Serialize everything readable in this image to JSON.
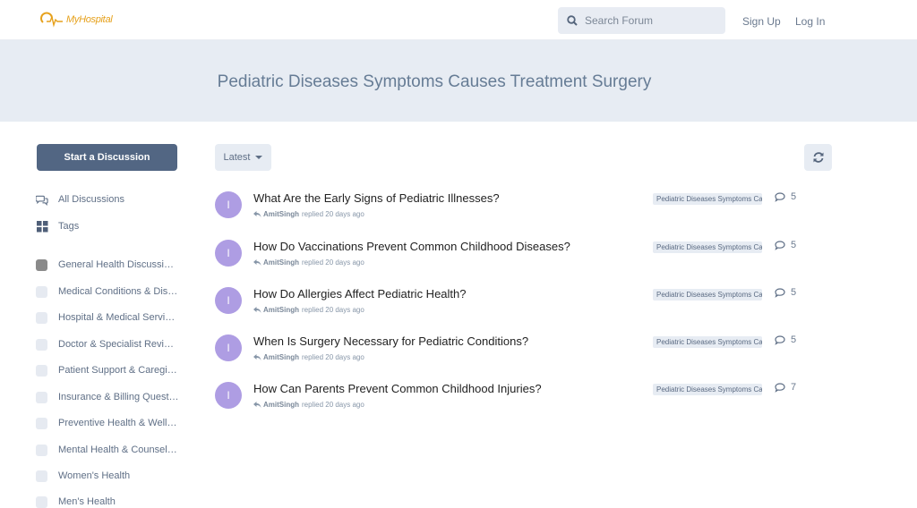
{
  "header": {
    "logo_text": "MyHospital",
    "search_placeholder": "Search Forum",
    "signup_label": "Sign Up",
    "login_label": "Log In"
  },
  "hero": {
    "title": "Pediatric Diseases Symptoms Causes Treatment Surgery"
  },
  "sidebar": {
    "start_button": "Start a Discussion",
    "nav": [
      {
        "label": "All Discussions",
        "icon": "comments-icon"
      },
      {
        "label": "Tags",
        "icon": "grid-icon"
      }
    ],
    "tags": [
      {
        "label": "General Health Discussions",
        "color": "#8a8a8a"
      },
      {
        "label": "Medical Conditions & Diseases",
        "color": "#e6eaf1"
      },
      {
        "label": "Hospital & Medical Services",
        "color": "#e6eaf1"
      },
      {
        "label": "Doctor & Specialist Reviews",
        "color": "#e6eaf1"
      },
      {
        "label": "Patient Support & Caregiving",
        "color": "#e6eaf1"
      },
      {
        "label": "Insurance & Billing Questions",
        "color": "#e6eaf1"
      },
      {
        "label": "Preventive Health & Wellness",
        "color": "#e6eaf1"
      },
      {
        "label": "Mental Health & Counseling",
        "color": "#e6eaf1"
      },
      {
        "label": "Women's Health",
        "color": "#e6eaf1"
      },
      {
        "label": "Men's Health",
        "color": "#e6eaf1"
      }
    ]
  },
  "toolbar": {
    "sort_label": "Latest"
  },
  "discussions": [
    {
      "avatar": "I",
      "title": "What Are the Early Signs of Pediatric Illnesses?",
      "user": "AmitSingh",
      "action": "replied 20 days ago",
      "tag": "Pediatric Diseases Symptoms Causes Treatment Surgery",
      "replies": "5"
    },
    {
      "avatar": "I",
      "title": "How Do Vaccinations Prevent Common Childhood Diseases?",
      "user": "AmitSingh",
      "action": "replied 20 days ago",
      "tag": "Pediatric Diseases Symptoms Causes Treatment Surgery",
      "replies": "5"
    },
    {
      "avatar": "I",
      "title": "How Do Allergies Affect Pediatric Health?",
      "user": "AmitSingh",
      "action": "replied 20 days ago",
      "tag": "Pediatric Diseases Symptoms Causes Treatment Surgery",
      "replies": "5"
    },
    {
      "avatar": "I",
      "title": "When Is Surgery Necessary for Pediatric Conditions?",
      "user": "AmitSingh",
      "action": "replied 20 days ago",
      "tag": "Pediatric Diseases Symptoms Causes Treatment Surgery",
      "replies": "5"
    },
    {
      "avatar": "I",
      "title": "How Can Parents Prevent Common Childhood Injuries?",
      "user": "AmitSingh",
      "action": "replied 20 days ago",
      "tag": "Pediatric Diseases Symptoms Causes Treatment Surgery",
      "replies": "7"
    }
  ]
}
